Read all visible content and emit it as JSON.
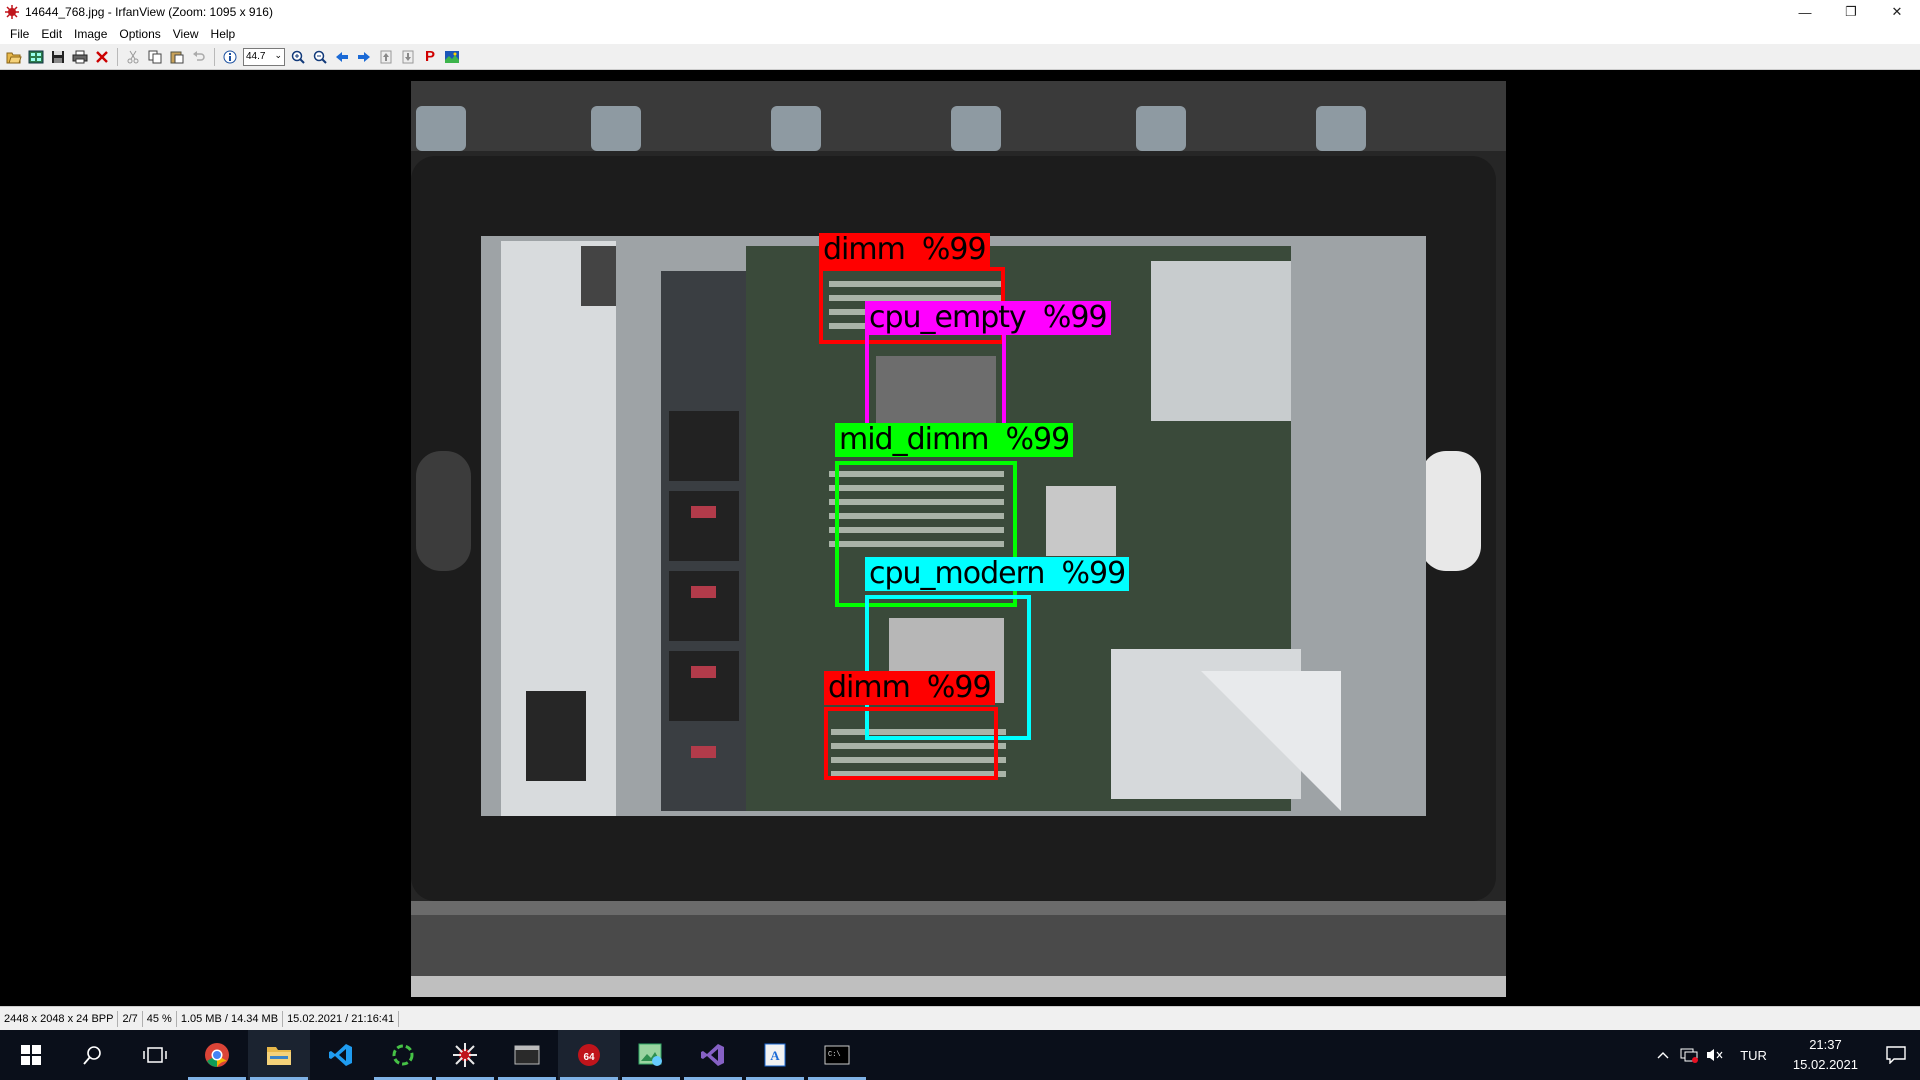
{
  "window": {
    "title": "14644_768.jpg - IrfanView (Zoom: 1095 x 916)",
    "minimize": "—",
    "restore": "❐",
    "close": "✕"
  },
  "menu": [
    "File",
    "Edit",
    "Image",
    "Options",
    "View",
    "Help"
  ],
  "toolbar": {
    "zoom_value": "44.7",
    "icons": [
      "open-icon",
      "thumbnails-icon",
      "save-icon",
      "print-icon",
      "delete-icon",
      "cut-icon",
      "copy-icon",
      "paste-icon",
      "undo-icon",
      "info-icon",
      "zoom-in-icon",
      "zoom-out-icon",
      "previous-icon",
      "next-icon",
      "first-icon",
      "last-icon",
      "paint-icon",
      "slideshow-icon"
    ]
  },
  "detections": [
    {
      "label": "dimm  %99",
      "class": "dimm",
      "confidence": "%99",
      "color": "#ff0000"
    },
    {
      "label": "cpu_empty  %99",
      "class": "cpu_empty",
      "confidence": "%99",
      "color": "#ff00ff"
    },
    {
      "label": "mid_dimm  %99",
      "class": "mid_dimm",
      "confidence": "%99",
      "color": "#00ff00"
    },
    {
      "label": "cpu_modern  %99",
      "class": "cpu_modern",
      "confidence": "%99",
      "color": "#00ffff"
    },
    {
      "label": "dimm  %99",
      "class": "dimm",
      "confidence": "%99",
      "color": "#ff0000"
    }
  ],
  "status": {
    "dimensions": "2448 x 2048 x 24 BPP",
    "index": "2/7",
    "zoom": "45 %",
    "size": "1.05 MB / 14.34 MB",
    "datetime": "15.02.2021 / 21:16:41"
  },
  "taskbar": {
    "apps": [
      "start-icon",
      "search-icon",
      "task-view-icon",
      "chrome-icon",
      "file-explorer-icon",
      "vscode-icon",
      "sync-icon",
      "irfanview-icon",
      "terminal-icon",
      "irfanview64-icon",
      "image-editor-icon",
      "visual-studio-icon",
      "notepad-icon",
      "cmd-icon"
    ],
    "language": "TUR",
    "time": "21:37",
    "date": "15.02.2021"
  }
}
